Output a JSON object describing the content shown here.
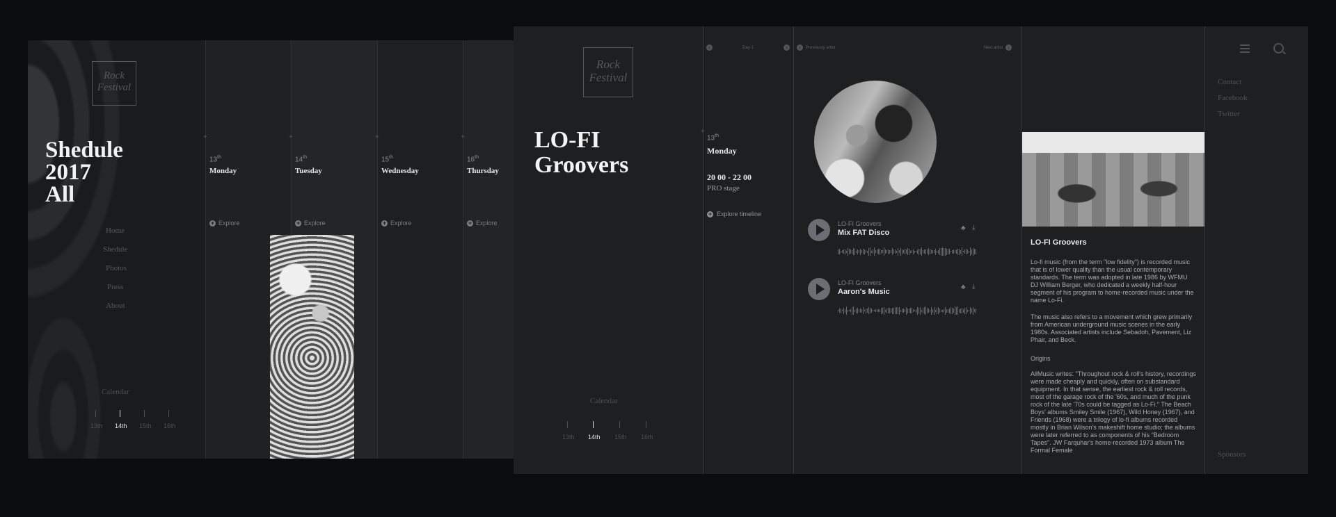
{
  "schedule": {
    "title_lines": [
      "Shedule",
      "2017",
      "All"
    ],
    "logo_text": [
      "Rock",
      "Festival"
    ],
    "nav": [
      "Home",
      "Shedule",
      "Photos",
      "Press",
      "About"
    ],
    "days": [
      {
        "num": "13",
        "sup": "th",
        "name": "Monday",
        "explore": "Explore"
      },
      {
        "num": "14",
        "sup": "th",
        "name": "Tuesday",
        "explore": "Explore"
      },
      {
        "num": "15",
        "sup": "th",
        "name": "Wednesday",
        "explore": "Explore"
      },
      {
        "num": "16",
        "sup": "th",
        "name": "Thursday",
        "explore": "Explore"
      }
    ],
    "calendar": {
      "label": "Calendar",
      "days": [
        {
          "label": "13th",
          "active": false
        },
        {
          "label": "14th",
          "active": true
        },
        {
          "label": "15th",
          "active": false
        },
        {
          "label": "16th",
          "active": false
        }
      ]
    }
  },
  "detail": {
    "logo_text": [
      "Rock",
      "Festival"
    ],
    "artist_title_lines": [
      "LO-FI",
      "Groovers"
    ],
    "top_nav": {
      "day": "Day 1",
      "prev": "Previously artist",
      "next": "Next artist"
    },
    "day_num": "13",
    "day_sup": "th",
    "day_name": "Monday",
    "time": "20 00 - 22 00",
    "stage": "PRO stage",
    "explore_timeline": "Explore timeline",
    "tracks": [
      {
        "artist": "LO-FI Groovers",
        "title": "Mix FAT Disco"
      },
      {
        "artist": "LO-FI Groovers",
        "title": "Aaron's Music"
      }
    ],
    "bio": {
      "title": "LO-FI Groovers",
      "p1": "Lo-fi music (from the term \"low fidelity\") is recorded music that is of lower quality than the usual contemporary standards. The term was adopted in late 1986 by WFMU DJ William Berger, who dedicated a weekly half-hour segment of his program to home-recorded music under the name Lo-Fi.",
      "p2": "The music also refers to a movement which grew primarily from American underground music scenes in the early 1980s. Associated artists include Sebadoh, Pavement, Liz Phair, and Beck.",
      "h": "Origins",
      "p3": "AllMusic writes: \"Throughout rock & roll's history, recordings were made cheaply and quickly, often on substandard equipment. In that sense, the earliest rock & roll records, most of the garage rock of the '60s, and much of the punk rock of the late '70s could be tagged as Lo-Fi.\" The Beach Boys' albums Smiley Smile (1967), Wild Honey (1967), and Friends (1968) were a trilogy of lo-fi albums recorded mostly in Brian Wilson's makeshift home studio; the albums were later referred to as components of his \"Bedroom Tapes\". JW Farquhar's home-recorded 1973 album The Formal Female"
    },
    "side_links": [
      "Contact",
      "Facebook",
      "Twitter"
    ],
    "sponsors": "Sponsors",
    "calendar": {
      "label": "Calendar",
      "days": [
        {
          "label": "13th",
          "active": false
        },
        {
          "label": "14th",
          "active": true
        },
        {
          "label": "15th",
          "active": false
        },
        {
          "label": "16th",
          "active": false
        }
      ]
    }
  }
}
